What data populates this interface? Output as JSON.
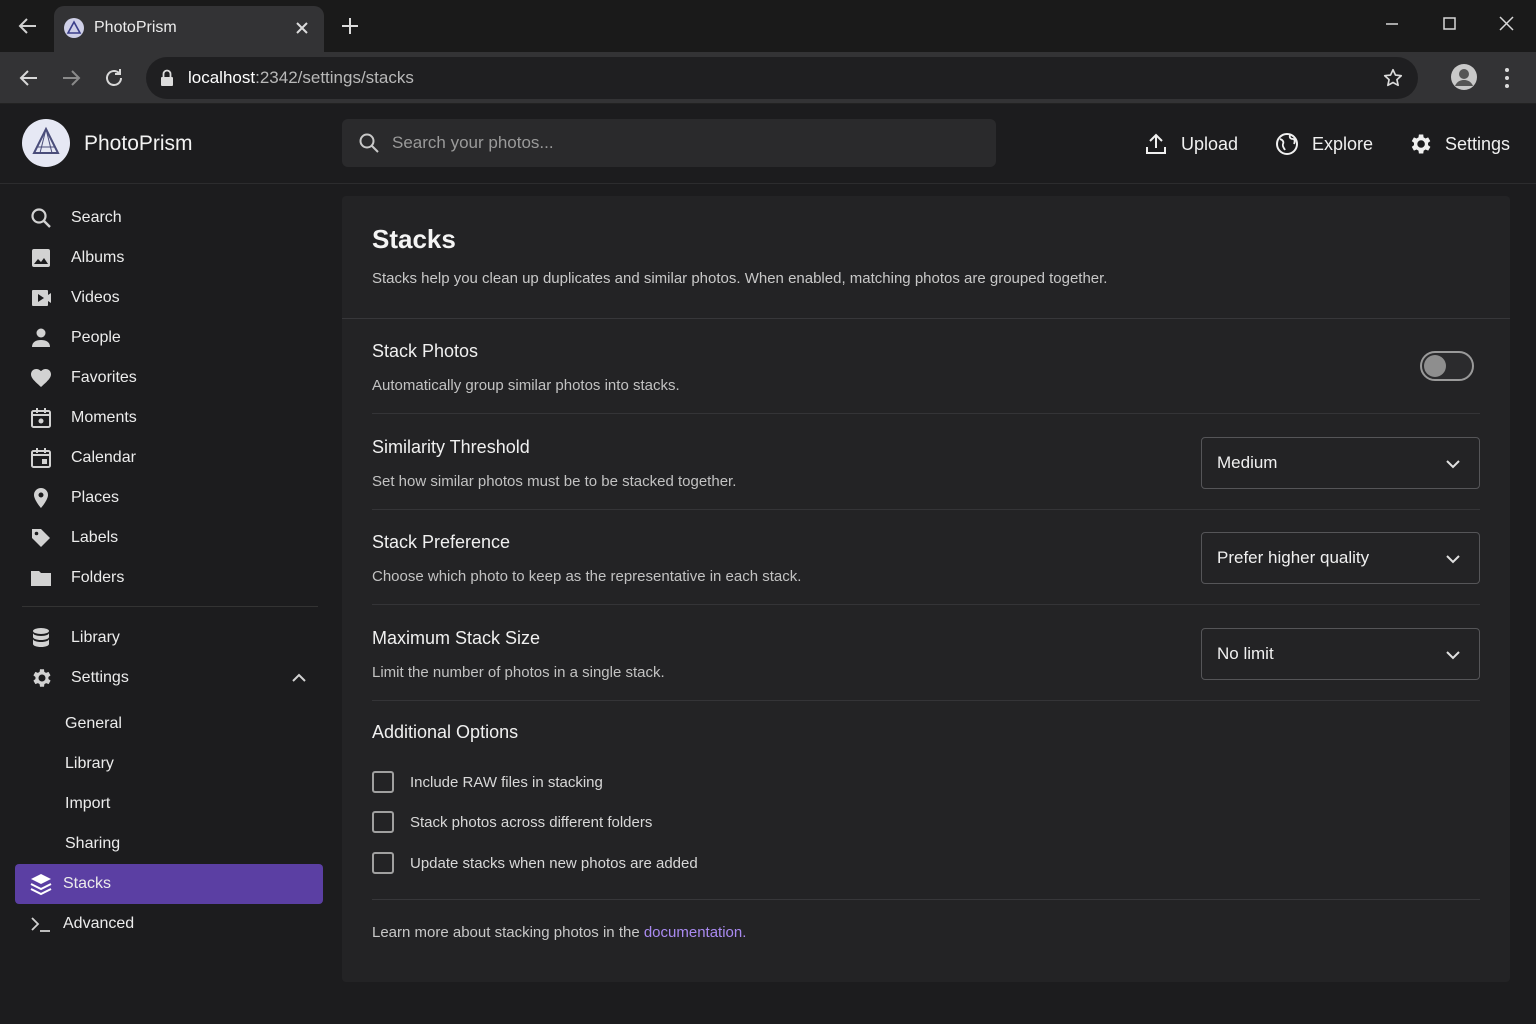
{
  "browser": {
    "tab_title": "PhotoPrism",
    "url_host": "localhost",
    "url_path": ":2342/settings/stacks"
  },
  "header": {
    "app_name": "PhotoPrism",
    "search_placeholder": "Search your photos...",
    "upload_label": "Upload",
    "explore_label": "Explore",
    "settings_label": "Settings"
  },
  "sidebar": {
    "items": [
      {
        "label": "Search",
        "icon": "search-icon"
      },
      {
        "label": "Albums",
        "icon": "image-icon"
      },
      {
        "label": "Videos",
        "icon": "video-icon"
      },
      {
        "label": "People",
        "icon": "person-icon"
      },
      {
        "label": "Favorites",
        "icon": "heart-icon"
      },
      {
        "label": "Moments",
        "icon": "calendar-moments-icon"
      },
      {
        "label": "Calendar",
        "icon": "calendar-icon"
      },
      {
        "label": "Places",
        "icon": "map-pin-icon"
      },
      {
        "label": "Labels",
        "icon": "tag-icon"
      },
      {
        "label": "Folders",
        "icon": "folder-icon"
      }
    ],
    "library_label": "Library",
    "settings_label": "Settings",
    "sub_items": [
      "General",
      "Library",
      "Import",
      "Sharing",
      "Stacks",
      "Advanced"
    ]
  },
  "main": {
    "title": "Stacks",
    "description": "Stacks help you clean up duplicates and similar photos. When enabled, matching photos are grouped together.",
    "stack_photos": {
      "title": "Stack Photos",
      "description": "Automatically group similar photos into stacks.",
      "enabled": false
    },
    "similarity": {
      "title": "Similarity Threshold",
      "description": "Set how similar photos must be to be stacked together.",
      "value": "Medium"
    },
    "preference": {
      "title": "Stack Preference",
      "description": "Choose which photo to keep as the representative in each stack.",
      "value": "Prefer higher quality"
    },
    "max_size": {
      "title": "Maximum Stack Size",
      "description": "Limit the number of photos in a single stack.",
      "value": "No limit"
    },
    "additional": {
      "title": "Additional Options",
      "options": [
        "Include RAW files in stacking",
        "Stack photos across different folders",
        "Update stacks when new photos are added"
      ]
    },
    "footer": {
      "text": "Learn more about stacking photos in the ",
      "link": "documentation."
    }
  },
  "colors": {
    "accent": "#5b3fa3",
    "link": "#a98af0",
    "background": "#1c1c1e"
  }
}
